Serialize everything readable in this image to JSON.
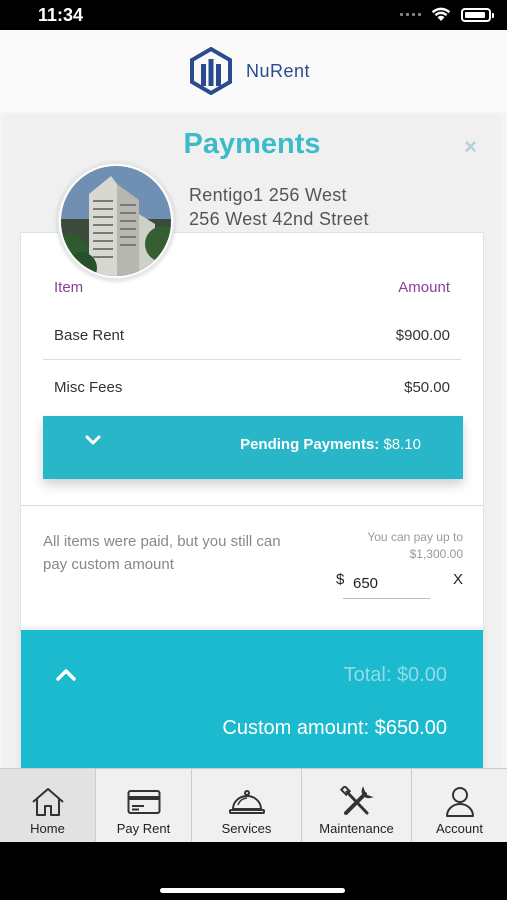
{
  "status_bar": {
    "time": "11:34"
  },
  "header": {
    "app_name": "NuRent"
  },
  "payments": {
    "title": "Payments",
    "close_icon": "×",
    "property": {
      "name": "Rentigo1 256 West",
      "address": "256 West 42nd Street"
    },
    "table": {
      "headers": {
        "item": "Item",
        "amount": "Amount"
      },
      "rows": [
        {
          "label": "Base Rent",
          "amount": "$900.00"
        },
        {
          "label": "Misc Fees",
          "amount": "$50.00"
        }
      ]
    },
    "pending": {
      "label": "Pending Payments:",
      "amount": "$8.10"
    },
    "custom": {
      "note": "All items were paid, but you still can pay custom amount",
      "limit_line1": "You can pay up to",
      "limit_line2": "$1,300.00",
      "currency": "$",
      "value": "650",
      "clear": "X"
    },
    "totals": {
      "total": "Total: $0.00",
      "custom_amount": "Custom amount: $650.00"
    }
  },
  "tabs": [
    {
      "label": "Home",
      "icon": "home-icon"
    },
    {
      "label": "Pay Rent",
      "icon": "credit-card-icon"
    },
    {
      "label": "Services",
      "icon": "service-bell-icon"
    },
    {
      "label": "Maintenance",
      "icon": "tools-icon"
    },
    {
      "label": "Account",
      "icon": "user-icon"
    }
  ],
  "colors": {
    "accent": "#29b6c8",
    "title": "#3cbccb",
    "header_label": "#8a3f9b",
    "brand": "#2a4c8f"
  }
}
